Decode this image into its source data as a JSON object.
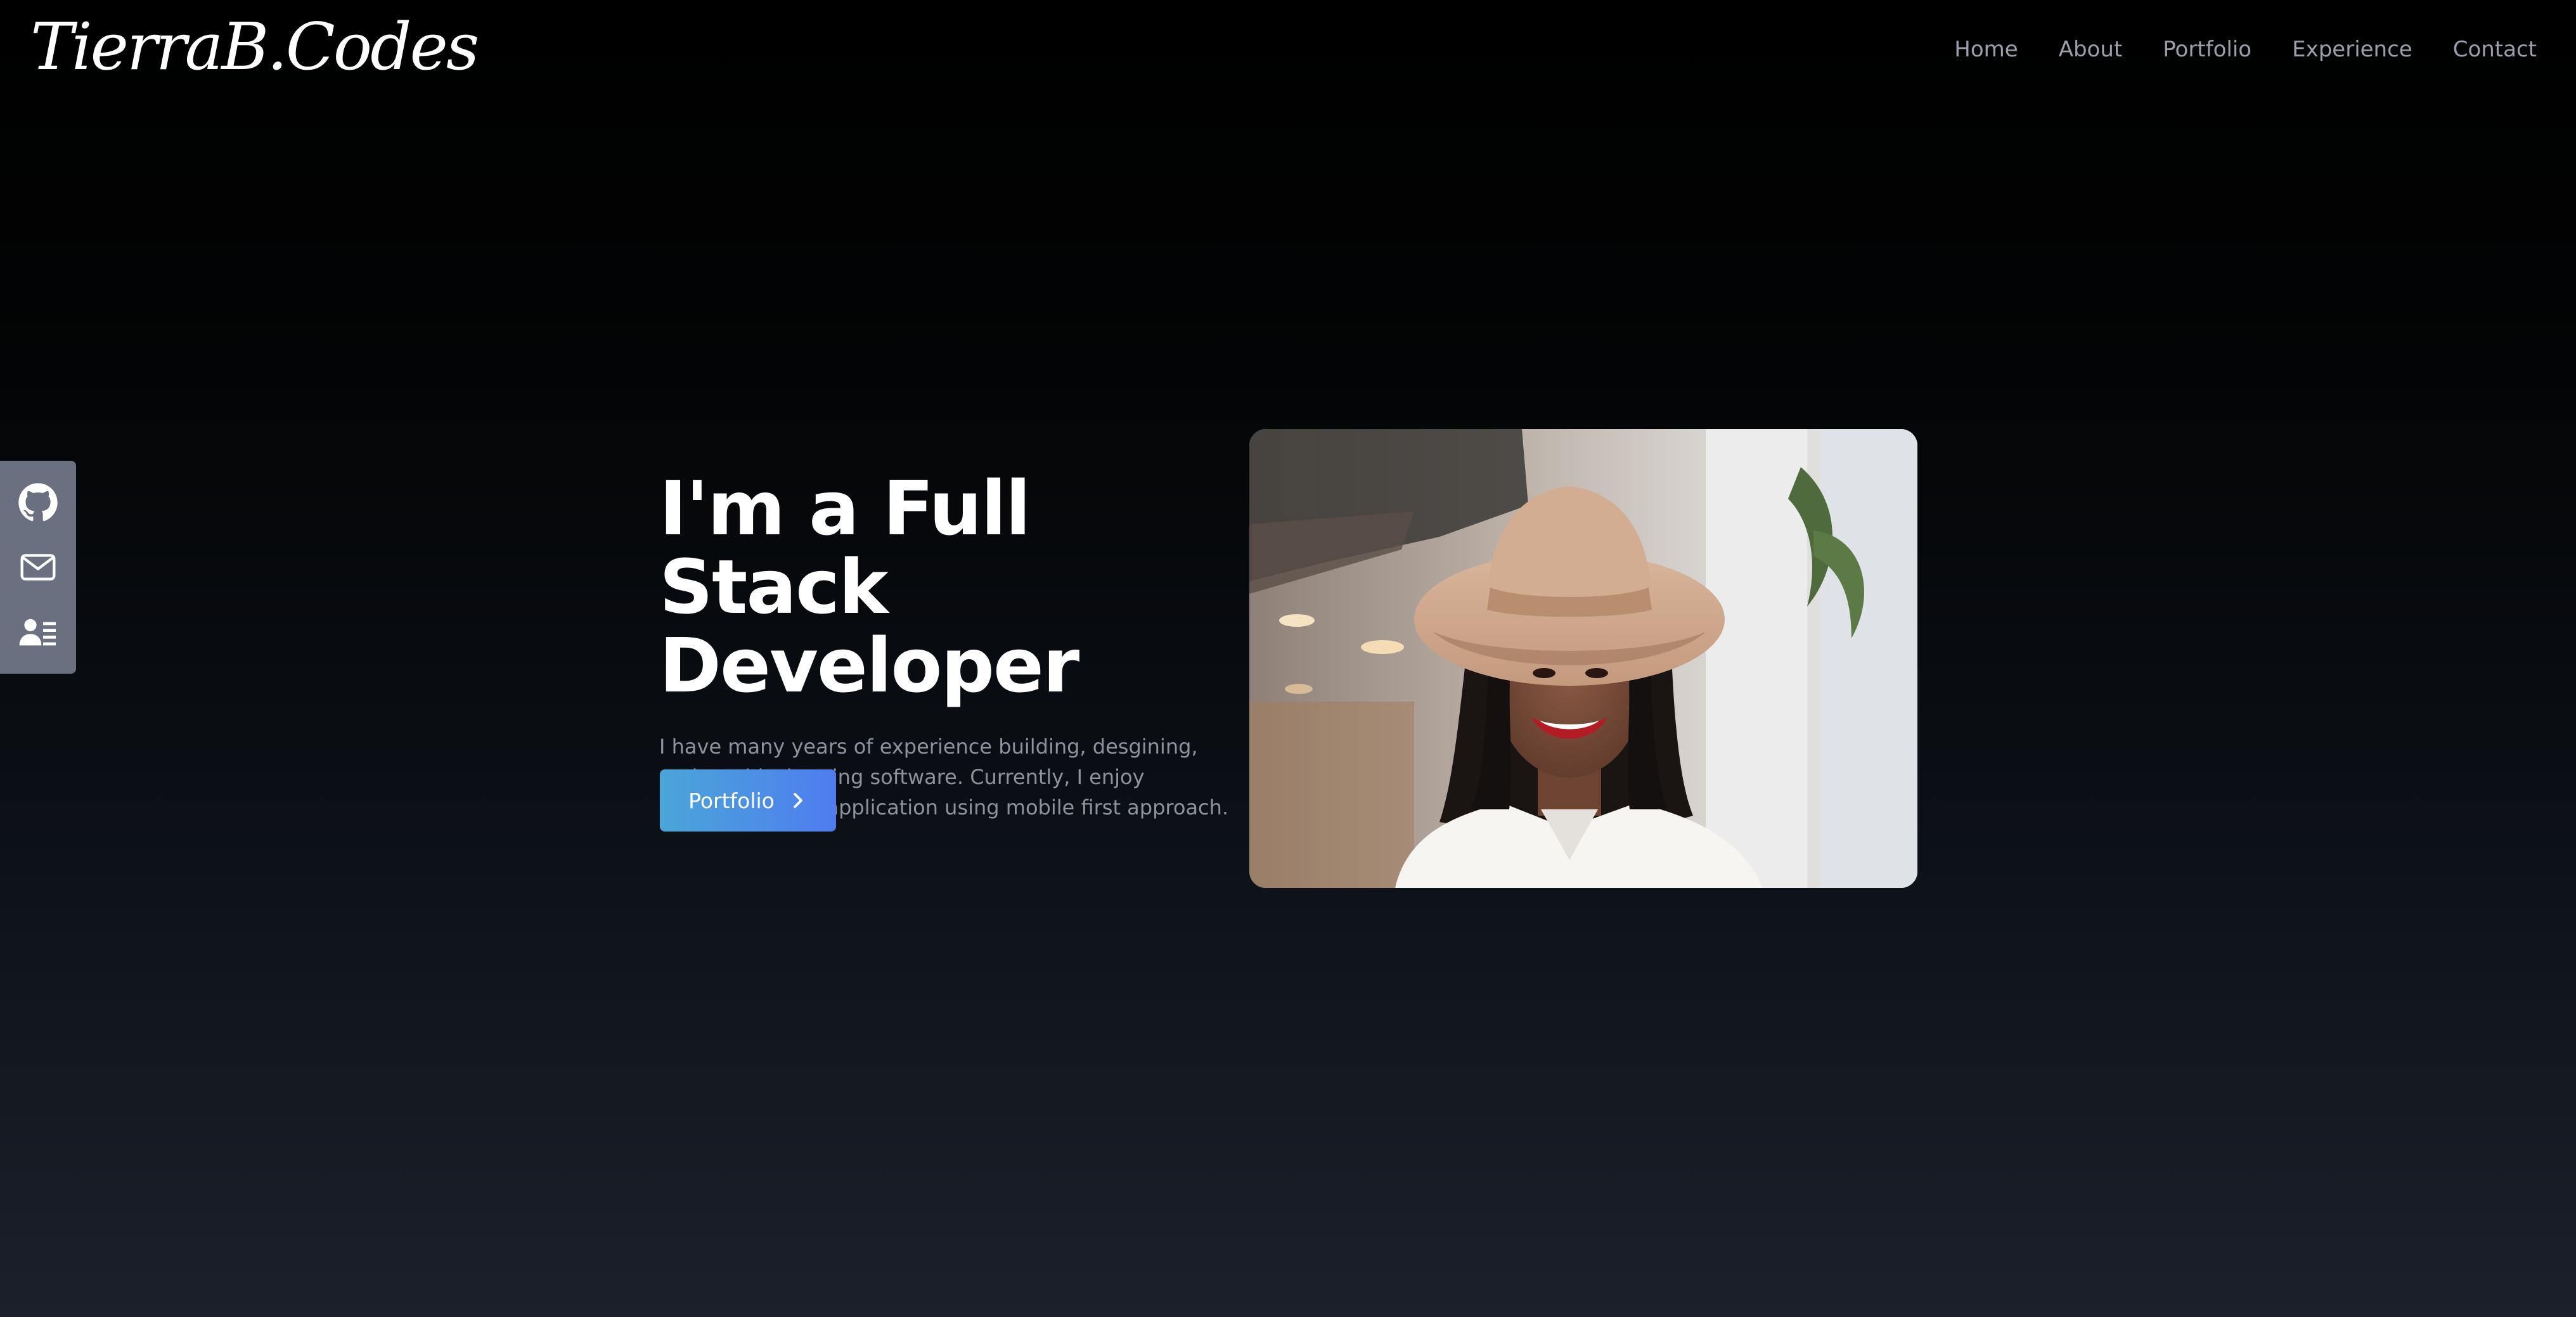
{
  "site": {
    "logo_text": "TierraB.Codes"
  },
  "nav": {
    "items": [
      {
        "label": "Home"
      },
      {
        "label": "About"
      },
      {
        "label": "Portfolio"
      },
      {
        "label": "Experience"
      },
      {
        "label": "Contact"
      }
    ]
  },
  "social": {
    "items": [
      {
        "icon": "github-icon"
      },
      {
        "icon": "mail-icon"
      },
      {
        "icon": "resume-icon"
      }
    ]
  },
  "hero": {
    "heading_line1": "I'm a Full Stack",
    "heading_line2": "Developer",
    "description": "I have many years of experience building, desgining, and troubleshooting software. Currently, I enjoy working on web application using mobile first approach.",
    "button_label": "Portfolio",
    "button_icon": "chevron-right-icon"
  },
  "colors": {
    "background_top": "#000000",
    "background_bottom": "#1b202b",
    "nav_text": "#9aa0ab",
    "social_bar": "#6b7080",
    "button_gradient_start": "#4aa6d8",
    "button_gradient_end": "#4f7cf0"
  }
}
